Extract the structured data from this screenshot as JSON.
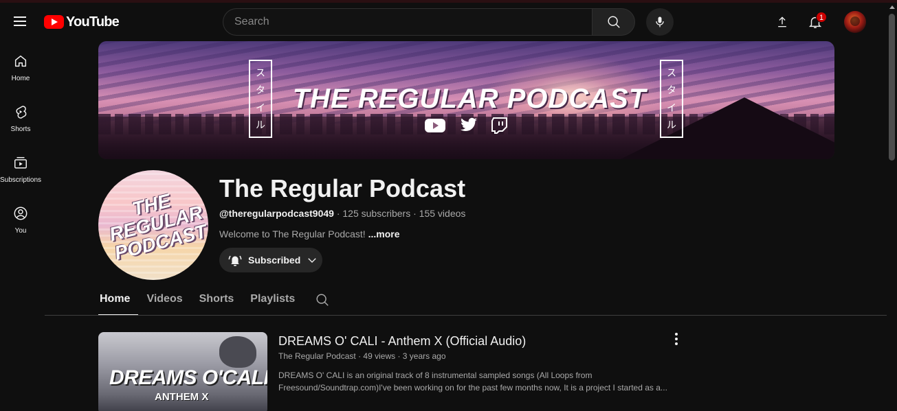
{
  "header": {
    "logo_text": "YouTube",
    "search_placeholder": "Search",
    "notification_count": "1"
  },
  "sidebar": {
    "items": [
      {
        "label": "Home",
        "icon": "home-icon"
      },
      {
        "label": "Shorts",
        "icon": "shorts-icon"
      },
      {
        "label": "Subscriptions",
        "icon": "subscriptions-icon"
      },
      {
        "label": "You",
        "icon": "you-icon"
      }
    ]
  },
  "banner": {
    "title": "THE REGULAR PODCAST",
    "vertical_text": [
      "ス",
      "タ",
      "イ",
      "ル"
    ],
    "socials": [
      "youtube-icon",
      "twitter-icon",
      "twitch-icon"
    ]
  },
  "channel": {
    "avatar_text": "THE REGULAR PODCAST",
    "name": "The Regular Podcast",
    "handle": "@theregularpodcast9049",
    "subscribers": "125 subscribers",
    "videos": "155 videos",
    "description": "Welcome to The Regular Podcast!",
    "more_label": "...more",
    "subscribe_label": "Subscribed"
  },
  "tabs": [
    {
      "label": "Home",
      "active": true
    },
    {
      "label": "Videos",
      "active": false
    },
    {
      "label": "Shorts",
      "active": false
    },
    {
      "label": "Playlists",
      "active": false
    }
  ],
  "featured_video": {
    "thumbnail_title": "DREAMS O'CALI",
    "thumbnail_subtitle": "ANTHEM X",
    "title": "DREAMS O' CALI - Anthem X (Official Audio)",
    "channel": "The Regular Podcast",
    "views": "49 views",
    "age": "3 years ago",
    "description": "DREAMS O' CALI is an original track of 8 instrumental sampled songs (All Loops from Freesound/Soundtrap.com)I've been working on for the past few months now, It is a project I started as a..."
  },
  "colors": {
    "background": "#0f0f0f",
    "brand_red": "#ff0000",
    "badge_red": "#cc0000",
    "text_primary": "#f1f1f1",
    "text_secondary": "#aaaaaa",
    "chip_bg": "#272727"
  }
}
